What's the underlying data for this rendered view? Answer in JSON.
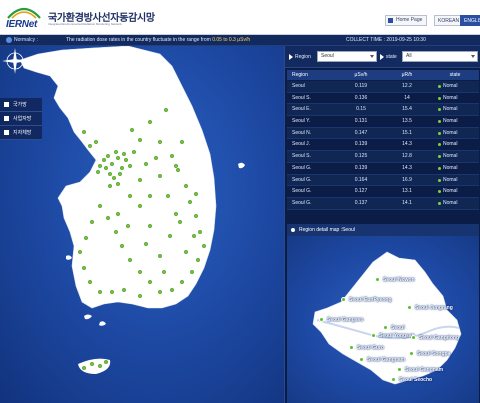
{
  "header": {
    "logo_text": "IERNet",
    "title": "국가환경방사선자동감시망",
    "subtitle": "Integrated Environmental Radiation Monitoring Network",
    "home_label": "Home Page",
    "lang_korean": "KOREAN",
    "lang_english": "ENGLISH"
  },
  "notice": {
    "label": "Normalcy :",
    "message": "The radiation dose rates in the country fluctuate in the range from",
    "range": "0.05 to 0.3 μSv/h",
    "collect_time": "COLLECT TIME : 2019-09-25 10:30"
  },
  "side_menu": [
    "국가망",
    "사업자망",
    "지자체망"
  ],
  "filters": {
    "region_label": "Region",
    "region_value": "Seoul",
    "state_label": "state",
    "state_value": "All"
  },
  "table": {
    "headers": [
      "Region",
      "μSv/h",
      "μR/h",
      "state"
    ],
    "rows": [
      [
        "Seoul",
        "0.119",
        "12.2",
        "Nomal"
      ],
      [
        "Seoul S.",
        "0.136",
        "14",
        "Nomal"
      ],
      [
        "Seoul E.",
        "0.15",
        "15.4",
        "Nomal"
      ],
      [
        "Seoul Y.",
        "0.131",
        "13.5",
        "Nomal"
      ],
      [
        "Seoul N.",
        "0.147",
        "15.1",
        "Nomal"
      ],
      [
        "Seoul J.",
        "0.139",
        "14.3",
        "Nomal"
      ],
      [
        "Seoul S.",
        "0.125",
        "12.8",
        "Nomal"
      ],
      [
        "Seoul G.",
        "0.139",
        "14.3",
        "Nomal"
      ],
      [
        "Seoul G.",
        "0.164",
        "16.9",
        "Nomal"
      ],
      [
        "Seoul G.",
        "0.127",
        "13.1",
        "Nomal"
      ],
      [
        "Seoul G.",
        "0.137",
        "14.1",
        "Nomal"
      ]
    ]
  },
  "detail": {
    "title": "Region detail map :Seoul",
    "labels": [
      "Seoul Nowon",
      "Seoul EunPyeong",
      "Seoul Jungrang",
      "Seoul Gangseo",
      "Seoul",
      "Seoul Yongsan",
      "Seoul Gangdong",
      "Seoul Guro",
      "Seoul Gangnam",
      "Seoul Songpa",
      "Seoul Gangnam",
      "Seoul Seocho"
    ]
  },
  "colors": {
    "accent": "#2a4fa0",
    "map_blue": "#1c47a0",
    "land": "#ffffff",
    "station_dot": "#6cc532",
    "normal_status": "#7ad33a"
  },
  "icons": [
    "home-icon",
    "compass-icon",
    "station-dot-icon",
    "notice-icon"
  ]
}
